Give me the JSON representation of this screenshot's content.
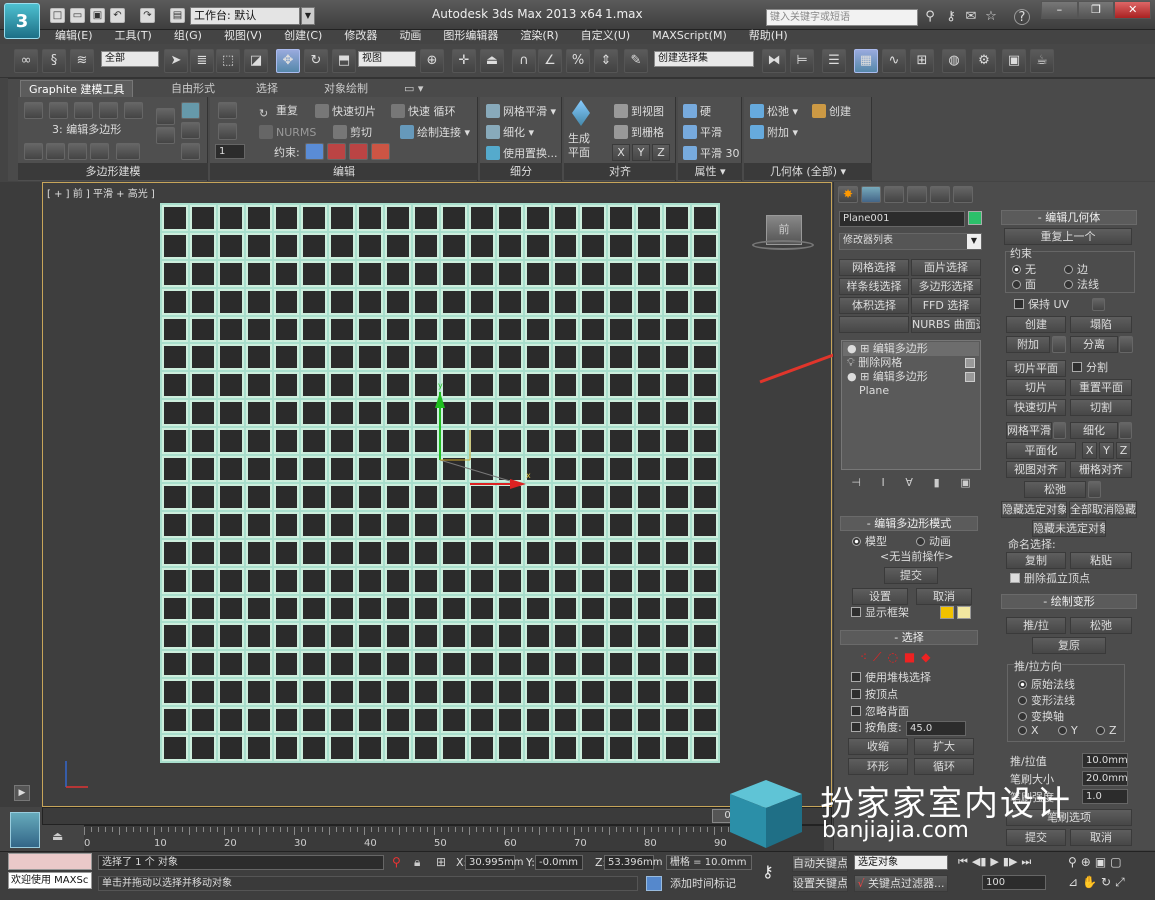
{
  "title_bar": {
    "workspace_label": "工作台: 默认",
    "app_title": "Autodesk 3ds Max  2013 x64",
    "file_name": "1.max",
    "search_placeholder": "键入关键字或短语",
    "logo_char": "3"
  },
  "menu": [
    "编辑(E)",
    "工具(T)",
    "组(G)",
    "视图(V)",
    "创建(C)",
    "修改器",
    "动画",
    "图形编辑器",
    "渲染(R)",
    "自定义(U)",
    "MAXScript(M)",
    "帮助(H)"
  ],
  "main_toolbar": {
    "selection_filter": "全部",
    "ref_coord": "视图",
    "named_selection": "创建选择集"
  },
  "ribbon": {
    "tabs": [
      "Graphite 建模工具",
      "自由形式",
      "选择",
      "对象绘制"
    ],
    "panel_polymodel": {
      "label": "3: 编辑多边形",
      "footer": "多边形建模"
    },
    "panel_edit": {
      "footer": "编辑",
      "redo": "重复",
      "quickslice": "快速切片",
      "quickloop": "快速 循环",
      "nurms": "NURMS",
      "cut": "剪切",
      "paintconnect": "绘制连接",
      "constraint": "约束:",
      "spin_value": "1"
    },
    "panel_subdiv": {
      "footer": "细分",
      "meshsmooth": "网格平滑",
      "tessellate": "细化",
      "use_displace": "使用置换..."
    },
    "panel_align": {
      "footer": "对齐",
      "make_planar": "生成\n平面",
      "to_view": "到视图",
      "to_grid": "到栅格",
      "x": "X",
      "y": "Y",
      "z": "Z"
    },
    "panel_props": {
      "footer": "属性",
      "hard": "硬",
      "smooth": "平滑",
      "smooth30": "平滑 30"
    },
    "panel_geom": {
      "footer": "几何体 (全部)",
      "relax": "松弛",
      "create": "创建",
      "attach": "附加"
    }
  },
  "viewport": {
    "label": "[ + ] 前 ] 平滑 + 高光 ]",
    "viewcube_label": "前"
  },
  "ruler": {
    "ticks": [
      "0",
      "10",
      "20",
      "30",
      "40",
      "50",
      "60",
      "70",
      "80",
      "90"
    ]
  },
  "command_panel": {
    "object_name": "Plane001",
    "object_color": "#2cc06a",
    "modifier_list": "修改器列表",
    "mod_buttons": [
      "网格选择",
      "面片选择",
      "样条线选择",
      "多边形选择",
      "体积选择",
      "FFD 选择",
      "",
      "NURBS 曲面选择"
    ],
    "stack": [
      {
        "name": "编辑多边形",
        "selected": true
      },
      {
        "name": "删除网格",
        "selected": false
      },
      {
        "name": "编辑多边形",
        "selected": false
      },
      {
        "name": "Plane",
        "selected": false
      }
    ],
    "edit_poly_mode": {
      "title": "编辑多边形模式",
      "model": "模型",
      "animate": "动画",
      "no_op": "<无当前操作>",
      "commit": "提交",
      "settings": "设置",
      "cancel": "取消",
      "show_cage": "显示框架"
    },
    "selection": {
      "title": "选择",
      "use_stack": "使用堆栈选择",
      "by_vertex": "按顶点",
      "ignore_back": "忽略背面",
      "by_angle": "按角度:",
      "angle_value": "45.0",
      "shrink": "收缩",
      "grow": "扩大",
      "ring": "环形",
      "loop": "循环"
    },
    "edit_geometry": {
      "title": "编辑几何体",
      "repeat_last": "重复上一个",
      "constraint": "约束",
      "none": "无",
      "edge": "边",
      "face": "面",
      "normal": "法线",
      "preserve_uv": "保持 UV",
      "create": "创建",
      "collapse": "塌陷",
      "attach": "附加",
      "detach": "分离",
      "slice_plane": "切片平面",
      "split": "分割",
      "slice": "切片",
      "reset_plane": "重置平面",
      "quickslice": "快速切片",
      "cut": "切割",
      "meshsmooth": "网格平滑",
      "tessellate": "细化",
      "planarize": "平面化",
      "x": "X",
      "y": "Y",
      "z": "Z",
      "view_align": "视图对齐",
      "grid_align": "栅格对齐",
      "relax": "松弛",
      "hide_selected": "隐藏选定对象",
      "unhide_all": "全部取消隐藏",
      "hide_unselected": "隐藏未选定对象",
      "named_sel": "命名选择:",
      "copy": "复制",
      "paste": "粘贴",
      "delete_isolated": "删除孤立顶点"
    },
    "paint_deform": {
      "title": "绘制变形",
      "push_pull": "推/拉",
      "relax": "松弛",
      "revert": "复原",
      "direction": "推/拉方向",
      "original_normals": "原始法线",
      "deformed_normals": "变形法线",
      "transform_axis": "变换轴",
      "x": "X",
      "y": "Y",
      "z": "Z",
      "push_value_label": "推/拉值",
      "push_value": "10.0mm",
      "brush_size": "笔刷大小",
      "brush_size_value": "20.0mm",
      "brush_strength": "笔刷强度",
      "brush_strength_value": "1.0",
      "brush_options": "笔刷选项",
      "commit": "提交",
      "cancel": "取消"
    }
  },
  "timeline": {
    "frame": "0 / 100"
  },
  "status": {
    "listener": "欢迎使用 MAXSc",
    "selected": "选择了 1 个 对象",
    "hint": "单击并拖动以选择并移动对象",
    "x_label": "X:",
    "x_value": "30.995mm",
    "y_label": "Y:",
    "y_value": "-0.0mm",
    "z_label": "Z:",
    "z_value": "53.396mm",
    "grid": "栅格 = 10.0mm",
    "add_time_tag": "添加时间标记",
    "auto_key": "自动关键点",
    "set_key": "设置关键点",
    "key_mode": "选定对象",
    "key_filters": "关键点过滤器...",
    "frame_value": "100"
  },
  "watermark": {
    "brand": "扮家家室内设计",
    "url": "banjiajia.com"
  },
  "colors": {
    "grid_line": "#a9dfcd",
    "viewport_border": "#c7a55a",
    "arrow": "#e0352b",
    "watermark": "#ffffff"
  }
}
